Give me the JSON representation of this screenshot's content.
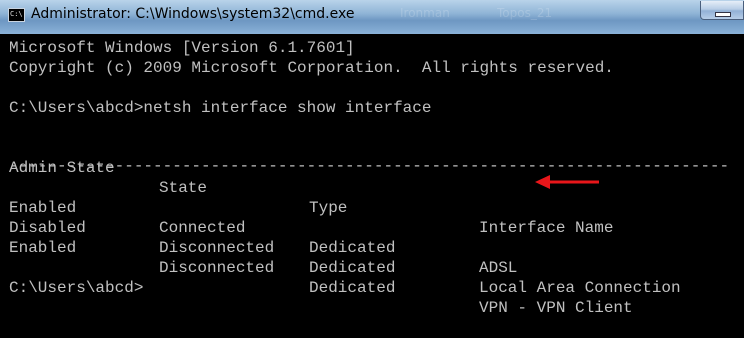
{
  "window": {
    "title": "Administrator: C:\\Windows\\system32\\cmd.exe",
    "icon_label": "C:\\.",
    "background_tabs": [
      "",
      "Ironman",
      "Topos_21"
    ]
  },
  "console": {
    "version_line": "Microsoft Windows [Version 6.1.7601]",
    "copyright_line": "Copyright (c) 2009 Microsoft Corporation.  All rights reserved.",
    "command_line": "C:\\Users\\abcd>netsh interface show interface",
    "separator": "---------------------------------------------------------------------------",
    "headers": [
      "Admin State",
      "State",
      "Type",
      "Interface Name"
    ],
    "rows": [
      [
        "Enabled",
        "Connected",
        "Dedicated",
        "ADSL"
      ],
      [
        "Disabled",
        "Disconnected",
        "Dedicated",
        "Local Area Connection"
      ],
      [
        "Enabled",
        "Disconnected",
        "Dedicated",
        "VPN - VPN Client"
      ]
    ],
    "prompt_line": "C:\\Users\\abcd>"
  },
  "colors": {
    "console_text": "#c0c0c0",
    "console_background": "#000000",
    "arrow": "#e8161a"
  },
  "icons": {
    "app": "cmd-icon",
    "annotation": "red-arrow-icon",
    "minimize": "minimize-icon"
  }
}
